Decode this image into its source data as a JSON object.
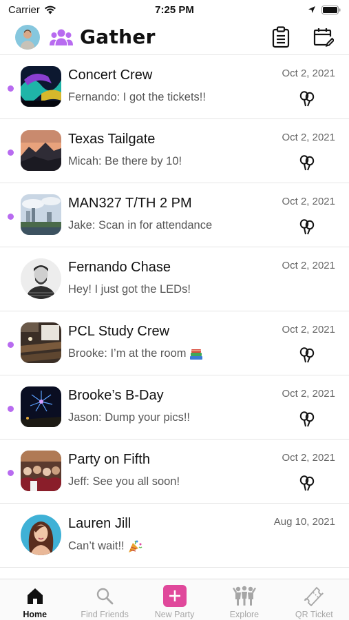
{
  "status_bar": {
    "carrier": "Carrier",
    "time": "7:25 PM"
  },
  "header": {
    "title": "Gather"
  },
  "chats": [
    {
      "name": "Concert Crew",
      "message": "Fernando: I got the tickets!!",
      "date": "Oct 2, 2021",
      "unread": true,
      "party": true
    },
    {
      "name": "Texas Tailgate",
      "message": "Micah: Be there by 10!",
      "date": "Oct 2, 2021",
      "unread": true,
      "party": true
    },
    {
      "name": "MAN327 T/TH 2 PM",
      "message": "Jake: Scan in for attendance",
      "date": "Oct 2, 2021",
      "unread": true,
      "party": true
    },
    {
      "name": "Fernando Chase",
      "message": "Hey! I just got the LEDs!",
      "date": "Oct 2, 2021",
      "unread": false,
      "party": false
    },
    {
      "name": "PCL Study Crew",
      "message": "Brooke: I’m at the room",
      "date": "Oct 2, 2021",
      "unread": true,
      "party": true
    },
    {
      "name": "Brooke’s B-Day",
      "message": "Jason: Dump your pics!!",
      "date": "Oct 2, 2021",
      "unread": true,
      "party": true
    },
    {
      "name": "Party on Fifth",
      "message": "Jeff: See you all soon!",
      "date": "Oct 2, 2021",
      "unread": true,
      "party": true
    },
    {
      "name": "Lauren Jill",
      "message": "Can’t wait!!",
      "date": "Aug 10, 2021",
      "unread": false,
      "party": false
    }
  ],
  "tabbar": {
    "tabs": [
      {
        "label": "Home",
        "icon": "home-icon",
        "active": true
      },
      {
        "label": "Find Friends",
        "icon": "search-icon",
        "active": false
      },
      {
        "label": "New Party",
        "icon": "plus-icon",
        "active": false
      },
      {
        "label": "Explore",
        "icon": "people-icon",
        "active": false
      },
      {
        "label": "QR Ticket",
        "icon": "ticket-icon",
        "active": false
      }
    ]
  },
  "colors": {
    "accent": "#b86bf0",
    "new_party": "#e0489b"
  }
}
